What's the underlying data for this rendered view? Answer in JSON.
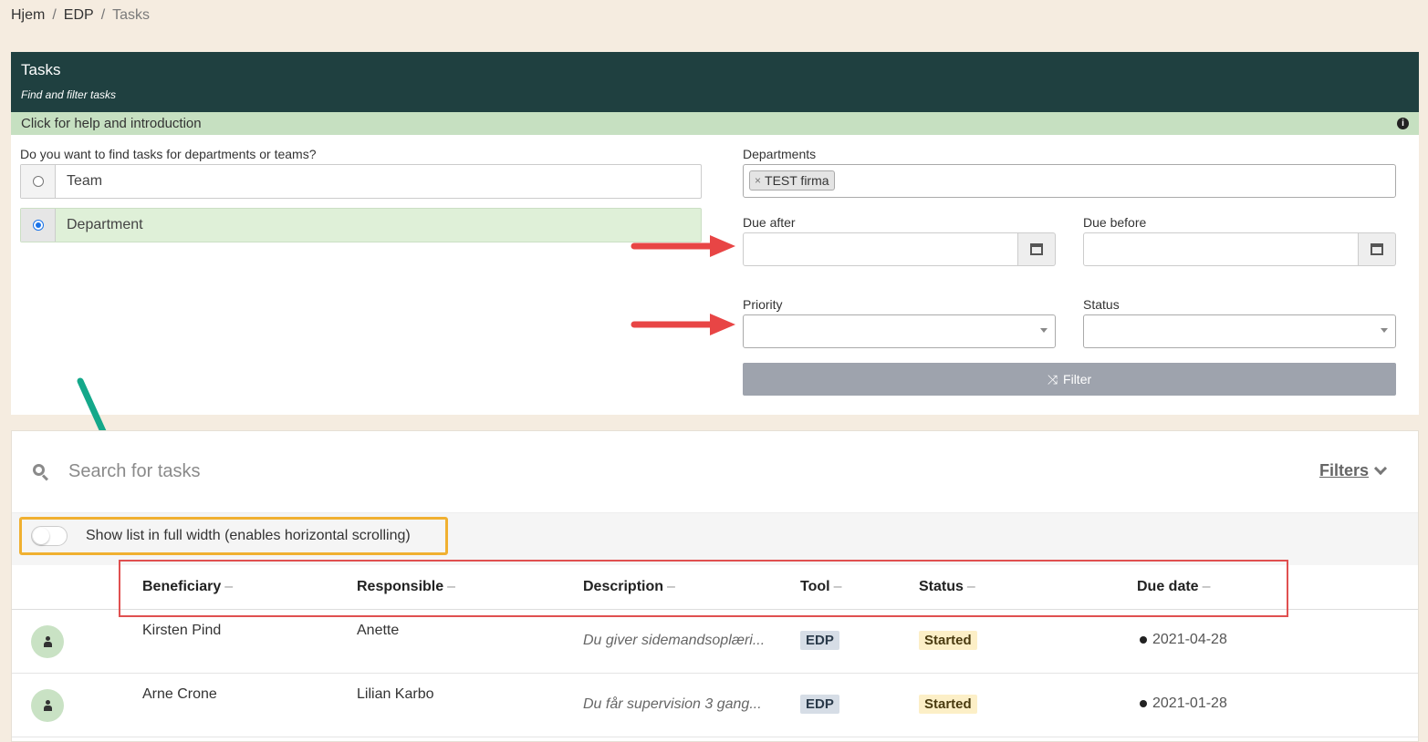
{
  "breadcrumb": {
    "items": [
      "Hjem",
      "EDP",
      "Tasks"
    ]
  },
  "header": {
    "title": "Tasks",
    "subtitle": "Find and filter tasks"
  },
  "help_bar": {
    "label": "Click for help and introduction",
    "icon": "info-icon"
  },
  "scope": {
    "question": "Do you want to find tasks for departments or teams?",
    "options": [
      {
        "label": "Team",
        "selected": false
      },
      {
        "label": "Department",
        "selected": true
      }
    ]
  },
  "filters_form": {
    "departments_label": "Departments",
    "departments_tag": "TEST firma",
    "due_after_label": "Due after",
    "due_before_label": "Due before",
    "priority_label": "Priority",
    "status_label": "Status",
    "filter_button": "Filter"
  },
  "search": {
    "placeholder": "Search for tasks",
    "filters_link": "Filters"
  },
  "toggle": {
    "label": "Show list in full width (enables horizontal scrolling)",
    "on": false
  },
  "table": {
    "columns": [
      "Beneficiary",
      "Responsible",
      "Description",
      "Tool",
      "Status",
      "Due date"
    ],
    "rows": [
      {
        "beneficiary": "Kirsten Pind",
        "responsible": "Anette",
        "description": "Du giver sidemandsoplæri...",
        "tool": "EDP",
        "status": "Started",
        "due": "2021-04-28"
      },
      {
        "beneficiary": "Arne Crone",
        "responsible": "Lilian Karbo",
        "description": "Du får supervision 3 gang...",
        "tool": "EDP",
        "status": "Started",
        "due": "2021-01-28"
      }
    ]
  },
  "colors": {
    "header_bg": "#1f4040",
    "help_bg": "#c6e0c1",
    "selected_row_bg": "#dff0d8",
    "filter_button_bg": "#9ea3ad",
    "annotation_red": "#e05050",
    "annotation_orange": "#f0b030",
    "annotation_green": "#14a88a"
  }
}
